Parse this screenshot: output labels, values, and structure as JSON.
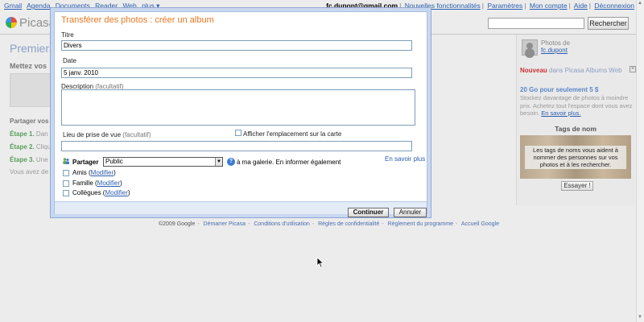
{
  "topbar": {
    "nav": [
      "Gmail",
      "Agenda",
      "Documents",
      "Reader",
      "Web",
      "plus ▾"
    ],
    "user_email": "fc.dupont@gmail.com",
    "links": [
      "Nouvelles fonctionnalités",
      "Paramètres",
      "Mon compte",
      "Aide",
      "Déconnexion"
    ]
  },
  "header": {
    "logo_text": "Picasa",
    "search_button": "Rechercher",
    "search_value": ""
  },
  "background": {
    "page_title": "Premiers",
    "lead": "Mettez vos",
    "share_heading": "Partager vos",
    "steps": [
      {
        "label": "Étape 1.",
        "text": "Dan"
      },
      {
        "label": "Étape 2.",
        "text": "Cliqu"
      },
      {
        "label": "Étape 3.",
        "text": "Une"
      }
    ],
    "vous_avez": "Vous avez de"
  },
  "sidebar": {
    "photos_de": "Photos de",
    "user": "fc.dupont",
    "news_new": "Nouveau",
    "news_text": "dans Picasa Albums Web",
    "news_close": "×",
    "promo_title": "20 Go pour seulement 5 $",
    "promo_text": "Stockez davantage de photos à moindre prix. Achetez tout l'espace dont vous avez besoin.",
    "promo_link": "En savoir plus.",
    "tags_heading": "Tags de nom",
    "tags_text": "Les tags de noms vous aident à nommer des personnes sur vos photos et à les rechercher.",
    "try_button": "Essayer !"
  },
  "footer": {
    "copyright": "©2009 Google",
    "links": [
      "Démarrer Picasa",
      "Conditions d'utilisation",
      "Règles de confidentialité",
      "Règlement du programme",
      "Accueil Google"
    ]
  },
  "dialog": {
    "title": "Transférer des photos : créer un album",
    "titre_label": "Titre",
    "titre_value": "Divers",
    "date_label": "Date",
    "date_value": "5 janv. 2010",
    "description_label": "Description",
    "description_optional": "(facultatif)",
    "description_value": "",
    "lieu_label": "Lieu de prise de vue",
    "lieu_optional": "(facultatif)",
    "lieu_value": "",
    "show_map_label": "Afficher l'emplacement sur la carte",
    "show_map_checked": false,
    "partager_label": "Partager",
    "partager_value": "Public",
    "galerie_text": "à ma galerie. En informer également",
    "en_savoir_plus": "En savoir plus",
    "groups": [
      {
        "name": "Amis",
        "link": "Modifier",
        "checked": false
      },
      {
        "name": "Famille",
        "link": "Modifier",
        "checked": false
      },
      {
        "name": "Collègues",
        "link": "Modifier",
        "checked": false
      }
    ],
    "continue_button": "Continuer",
    "cancel_button": "Annuler"
  },
  "colors": {
    "dialog_title": "#e87722",
    "link": "#2a5db0",
    "dialog_border": "#c9d8f0",
    "step_label": "#5a9e5a"
  }
}
